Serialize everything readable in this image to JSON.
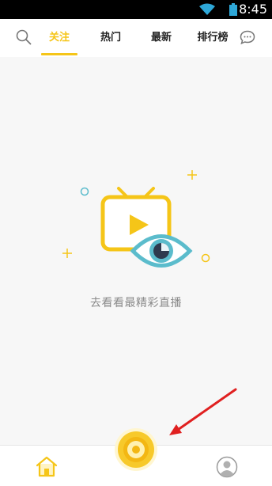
{
  "status_bar": {
    "time": "8:45",
    "icons": [
      "wifi-icon",
      "battery-icon"
    ]
  },
  "top_bar": {
    "tabs": [
      {
        "label": "关注",
        "active": true
      },
      {
        "label": "热门",
        "active": false
      },
      {
        "label": "最新",
        "active": false
      },
      {
        "label": "排行榜",
        "active": false
      }
    ],
    "left_icon": "search-icon",
    "right_icon": "chat-icon"
  },
  "empty_state": {
    "message": "去看看最精彩直播",
    "illustration": "tv-with-eye-illustration"
  },
  "bottom_bar": {
    "items": [
      "home-icon",
      "live-camera-button",
      "profile-icon"
    ]
  },
  "colors": {
    "accent": "#f5c518",
    "eye": "#5bbccc",
    "background": "#f7f7f7",
    "annotation": "#e02020"
  }
}
